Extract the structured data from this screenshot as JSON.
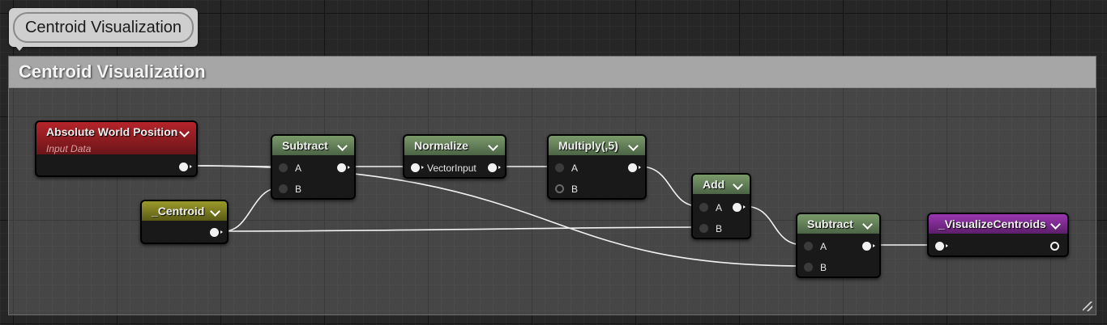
{
  "comment_bubble": {
    "text": "Centroid Visualization"
  },
  "comment_box": {
    "title": "Centroid Visualization"
  },
  "nodes": {
    "absolute_world_position": {
      "title": "Absolute World Position",
      "subtitle": "Input Data"
    },
    "centroid": {
      "title": "_Centroid"
    },
    "subtract_1": {
      "title": "Subtract",
      "pin_a": "A",
      "pin_b": "B"
    },
    "normalize": {
      "title": "Normalize",
      "pin_input": "VectorInput"
    },
    "multiply": {
      "title": "Multiply(,5)",
      "pin_a": "A",
      "pin_b": "B"
    },
    "add": {
      "title": "Add",
      "pin_a": "A",
      "pin_b": "B"
    },
    "subtract_2": {
      "title": "Subtract",
      "pin_a": "A",
      "pin_b": "B"
    },
    "visualize_centroids": {
      "title": "_VisualizeCentroids"
    }
  },
  "colors": {
    "canvas": "#262626",
    "wire": "#ffffff",
    "header_input": "#b5242a",
    "header_math": "#6a8a5e",
    "header_param": "#9b9a2a",
    "header_output": "#9a36b0"
  },
  "icons": [
    "chevron-down-icon",
    "resize-grip-icon"
  ]
}
